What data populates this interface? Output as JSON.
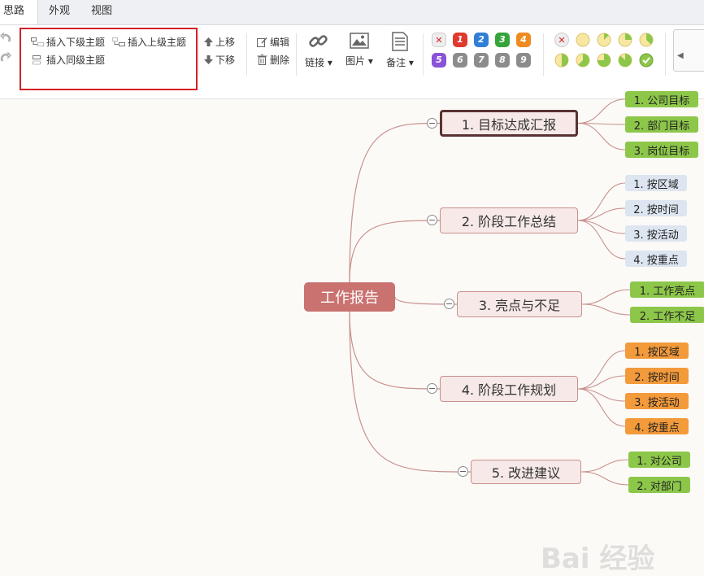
{
  "tabs": [
    {
      "label": "思路",
      "active": true
    },
    {
      "label": "外观",
      "active": false
    },
    {
      "label": "视图",
      "active": false
    }
  ],
  "toolbar": {
    "insert_child": "插入下级主题",
    "insert_parent": "插入上级主题",
    "insert_sibling": "插入同级主题",
    "move_up": "上移",
    "move_down": "下移",
    "edit": "编辑",
    "delete": "删除",
    "link": "链接",
    "image": "图片",
    "note": "备注",
    "priorities": [
      "1",
      "2",
      "3",
      "4",
      "5",
      "6",
      "7",
      "8",
      "9"
    ],
    "priority_colors": [
      "#e03a2f",
      "#2f7fd6",
      "#36a43a",
      "#f08a1e",
      "#8a52d9",
      "#8c8c8c",
      "#8c8c8c",
      "#8c8c8c",
      "#8c8c8c"
    ],
    "progress_levels": [
      "0",
      "1/8",
      "2/8",
      "3/8",
      "4/8",
      "5/8",
      "6/8",
      "7/8",
      "done"
    ]
  },
  "mindmap": {
    "root": "工作报告",
    "branches": [
      {
        "label": "1. 目标达成汇报",
        "selected": true,
        "color": "green",
        "children": [
          "1. 公司目标",
          "2. 部门目标",
          "3. 岗位目标"
        ]
      },
      {
        "label": "2. 阶段工作总结",
        "color": "blue",
        "children": [
          "1. 按区域",
          "2. 按时间",
          "3. 按活动",
          "4. 按重点"
        ]
      },
      {
        "label": "3. 亮点与不足",
        "color": "green",
        "children": [
          "1. 工作亮点",
          "2. 工作不足"
        ]
      },
      {
        "label": "4. 阶段工作规划",
        "color": "orange",
        "children": [
          "1. 按区域",
          "2. 按时间",
          "3. 按活动",
          "4. 按重点"
        ]
      },
      {
        "label": "5. 改进建议",
        "color": "green",
        "children": [
          "1. 对公司",
          "2. 对部门"
        ]
      }
    ]
  },
  "watermark": "Bai 经验"
}
